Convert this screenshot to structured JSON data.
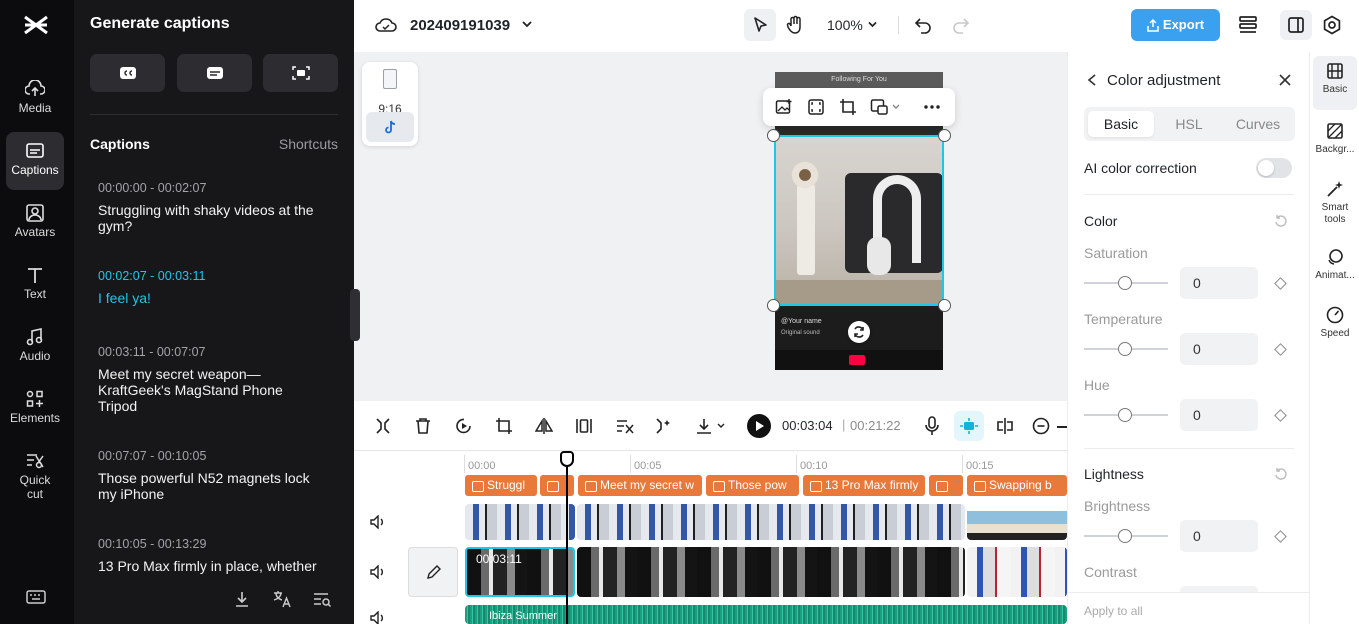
{
  "left_rail": {
    "items": [
      {
        "label": "Media"
      },
      {
        "label": "Captions"
      },
      {
        "label": "Avatars"
      },
      {
        "label": "Text"
      },
      {
        "label": "Audio"
      },
      {
        "label": "Elements"
      },
      {
        "label": "Quick cut"
      }
    ]
  },
  "captions_panel": {
    "title": "Generate captions",
    "captions_label": "Captions",
    "shortcuts_label": "Shortcuts",
    "items": [
      {
        "time": "00:00:00 - 00:02:07",
        "text": "Struggling with shaky videos at the gym?"
      },
      {
        "time": "00:02:07 - 00:03:11",
        "text": "I feel ya!"
      },
      {
        "time": "00:03:11 - 00:07:07",
        "text": "Meet my secret weapon—KraftGeek's MagStand Phone Tripod"
      },
      {
        "time": "00:07:07 - 00:10:05",
        "text": "Those powerful N52 magnets lock my iPhone"
      },
      {
        "time": "00:10:05 - 00:13:29",
        "text": "13 Pro Max firmly in place, whether"
      }
    ]
  },
  "topbar": {
    "project_name": "202409191039",
    "zoom": "100%",
    "export_label": "Export"
  },
  "canvas": {
    "ratio_label": "9:16",
    "tiktok_header": "Following   For You",
    "tiktok_user": "@Your name",
    "tiktok_sound": "Original sound"
  },
  "timeline_toolbar": {
    "current_time": "00:03:04",
    "total_time": "00:21:22",
    "separator": "|"
  },
  "timeline": {
    "ruler": [
      "00:00",
      "00:05",
      "00:10",
      "00:15"
    ],
    "caption_clips": [
      "Struggl",
      "",
      "Meet my secret w",
      "Those pow",
      "13 Pro Max firmly",
      "",
      "Swapping b"
    ],
    "current_clip_time": "00:03:11",
    "audio_clip": "Ibiza Summer"
  },
  "right_panel": {
    "title": "Color adjustment",
    "tabs": [
      "Basic",
      "HSL",
      "Curves"
    ],
    "ai_label": "AI color correction",
    "color_section": "Color",
    "saturation": {
      "label": "Saturation",
      "value": "0"
    },
    "temperature": {
      "label": "Temperature",
      "value": "0"
    },
    "hue": {
      "label": "Hue",
      "value": "0"
    },
    "lightness_section": "Lightness",
    "brightness": {
      "label": "Brightness",
      "value": "0"
    },
    "contrast": {
      "label": "Contrast"
    },
    "apply_all": "Apply to all"
  },
  "right_rail": {
    "items": [
      {
        "label": "Basic"
      },
      {
        "label": "Backgr..."
      },
      {
        "label": "Smart tools"
      },
      {
        "label": "Animat..."
      },
      {
        "label": "Speed"
      }
    ]
  }
}
